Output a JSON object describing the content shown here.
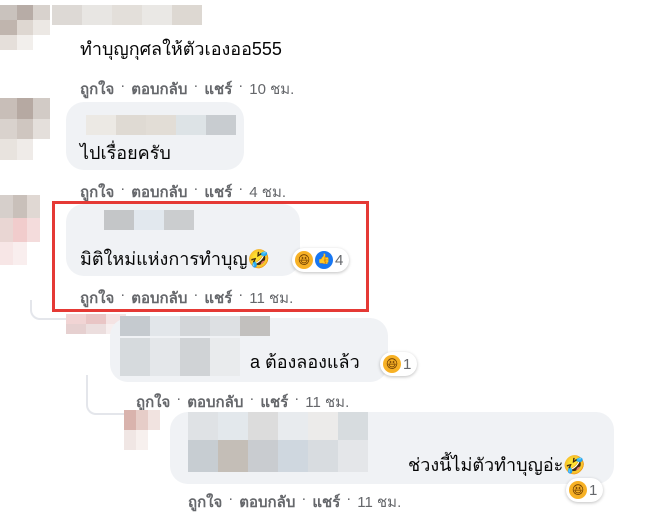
{
  "comments": [
    {
      "text": "ทำบุญกุศลให้ตัวเองออ555",
      "actions": {
        "like": "ถูกใจ",
        "reply": "ตอบกลับ",
        "share": "แชร์",
        "time": "10 ชม."
      }
    },
    {
      "text": "ไปเรื่อยครับ",
      "actions": {
        "like": "ถูกใจ",
        "reply": "ตอบกลับ",
        "share": "แชร์",
        "time": "4 ชม."
      }
    },
    {
      "text": "มิติใหม่แห่งการทำบุญ🤣",
      "reactions": {
        "types": [
          "haha-icon",
          "like-icon"
        ],
        "count": "4"
      },
      "actions": {
        "like": "ถูกใจ",
        "reply": "ตอบกลับ",
        "share": "แชร์",
        "time": "11 ชม."
      },
      "highlighted": true
    },
    {
      "text": "a ต้องลองแล้ว",
      "reactions": {
        "types": [
          "haha-icon"
        ],
        "count": "1"
      },
      "actions": {
        "like": "ถูกใจ",
        "reply": "ตอบกลับ",
        "share": "แชร์",
        "time": "11 ชม."
      }
    },
    {
      "text": "ช่วงนี้ไม่ตัวทำบุญอ่ะ🤣",
      "reactions": {
        "types": [
          "haha-icon"
        ],
        "count": "1"
      },
      "actions": {
        "like": "ถูกใจ",
        "reply": "ตอบกลับ",
        "share": "แชร์",
        "time": "11 ชม."
      }
    }
  ],
  "separator": "·",
  "colors": {
    "bubble": "#f0f2f5",
    "meta_text": "#65676b",
    "highlight_border": "#e53935",
    "haha": "#f7b125",
    "like": "#1877f2"
  },
  "emoji_glyphs": {
    "haha": "😆",
    "like": "👍"
  }
}
